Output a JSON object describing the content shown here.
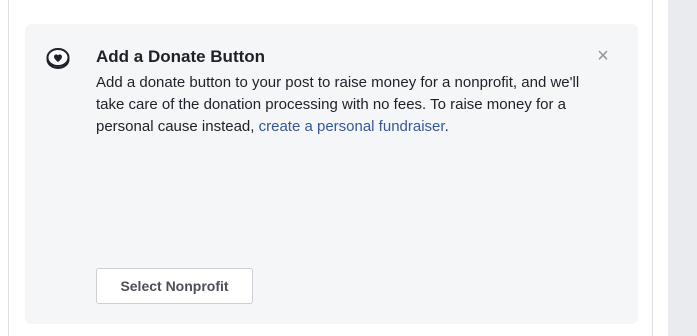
{
  "donate_card": {
    "icon": "heart-coin-icon",
    "title": "Add a Donate Button",
    "close_glyph": "×",
    "description": "Add a donate button to your post to raise money for a nonprofit, and we'll take care of the donation processing with no fees. To raise money for a personal cause instead,",
    "link_text": "create a personal fundraiser",
    "link_suffix": ".",
    "select_button_label": "Select Nonprofit"
  },
  "colors": {
    "card_background": "#f5f6f7",
    "title_text": "#1d2129",
    "link": "#365899",
    "close_icon": "#90949c",
    "side_panel": "#e9ebee"
  }
}
